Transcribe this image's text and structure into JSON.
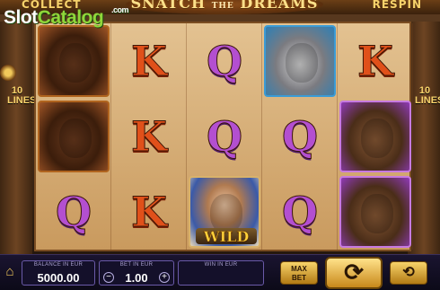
{
  "header": {
    "collect_label": "COLLECT",
    "title_main": "SNATCH",
    "title_small": "THE",
    "title_end": "DREAMS",
    "respin_label": "RESPIN"
  },
  "watermark": {
    "slot": "Slot",
    "catalog": "Catalog",
    "com": ".com"
  },
  "sides": {
    "lines_left": "10 LINES",
    "lines_right": "10 LINES"
  },
  "reels": [
    [
      {
        "type": "buffalo-icon"
      },
      {
        "type": "buffalo-icon"
      },
      {
        "type": "letter",
        "symbol": "Q"
      }
    ],
    [
      {
        "type": "letter",
        "symbol": "K"
      },
      {
        "type": "letter",
        "symbol": "K"
      },
      {
        "type": "letter",
        "symbol": "K"
      }
    ],
    [
      {
        "type": "letter",
        "symbol": "Q"
      },
      {
        "type": "letter",
        "symbol": "Q"
      },
      {
        "type": "chief-wild-icon",
        "label": "WILD"
      }
    ],
    [
      {
        "type": "wolf-icon"
      },
      {
        "type": "letter",
        "symbol": "Q"
      },
      {
        "type": "letter",
        "symbol": "Q"
      }
    ],
    [
      {
        "type": "letter",
        "symbol": "K"
      },
      {
        "type": "bear-icon"
      },
      {
        "type": "bear-icon"
      }
    ]
  ],
  "bottom": {
    "balance_label": "BALANCE IN EUR",
    "balance_value": "5000.00",
    "bet_label": "BET IN EUR",
    "bet_value": "1.00",
    "win_label": "WIN IN EUR",
    "win_value": "",
    "maxbet_line1": "MAX",
    "maxbet_line2": "BET",
    "minus": "−",
    "plus": "+",
    "home_icon": "home-icon",
    "spin_icon": "spin-icon",
    "autoplay_icon": "autoplay-icon"
  }
}
